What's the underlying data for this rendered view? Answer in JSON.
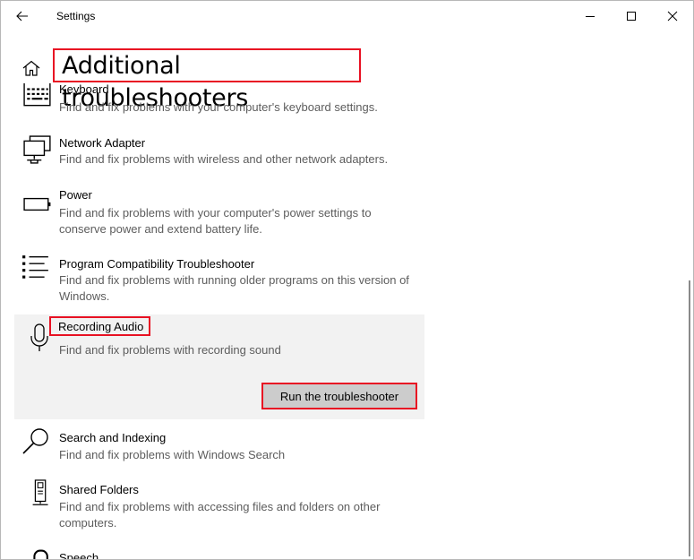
{
  "window": {
    "title": "Settings",
    "controls": {
      "minimize": "minimize",
      "maximize": "maximize",
      "close": "close"
    }
  },
  "page": {
    "title": "Additional troubleshooters"
  },
  "troubleshooters": [
    {
      "name": "Keyboard",
      "description": "Find and fix problems with your computer's keyboard settings.",
      "icon": "keyboard-icon"
    },
    {
      "name": "Network Adapter",
      "description": "Find and fix problems with wireless and other network adapters.",
      "icon": "network-adapter-icon"
    },
    {
      "name": "Power",
      "description": "Find and fix problems with your computer's power settings to conserve power and extend battery life.",
      "icon": "battery-icon"
    },
    {
      "name": "Program Compatibility Troubleshooter",
      "description": "Find and fix problems with running older programs on this version of Windows.",
      "icon": "list-icon"
    },
    {
      "name": "Recording Audio",
      "description": "Find and fix problems with recording sound",
      "icon": "microphone-icon",
      "selected": true,
      "action_label": "Run the troubleshooter"
    },
    {
      "name": "Search and Indexing",
      "description": "Find and fix problems with Windows Search",
      "icon": "search-icon"
    },
    {
      "name": "Shared Folders",
      "description": "Find and fix problems with accessing files and folders on other computers.",
      "icon": "server-tower-icon"
    },
    {
      "name": "Speech",
      "description": "",
      "icon": "speech-icon"
    }
  ],
  "colors": {
    "highlight_border": "#e81123",
    "selected_background": "#f2f2f2",
    "button_background": "#cccccc"
  }
}
